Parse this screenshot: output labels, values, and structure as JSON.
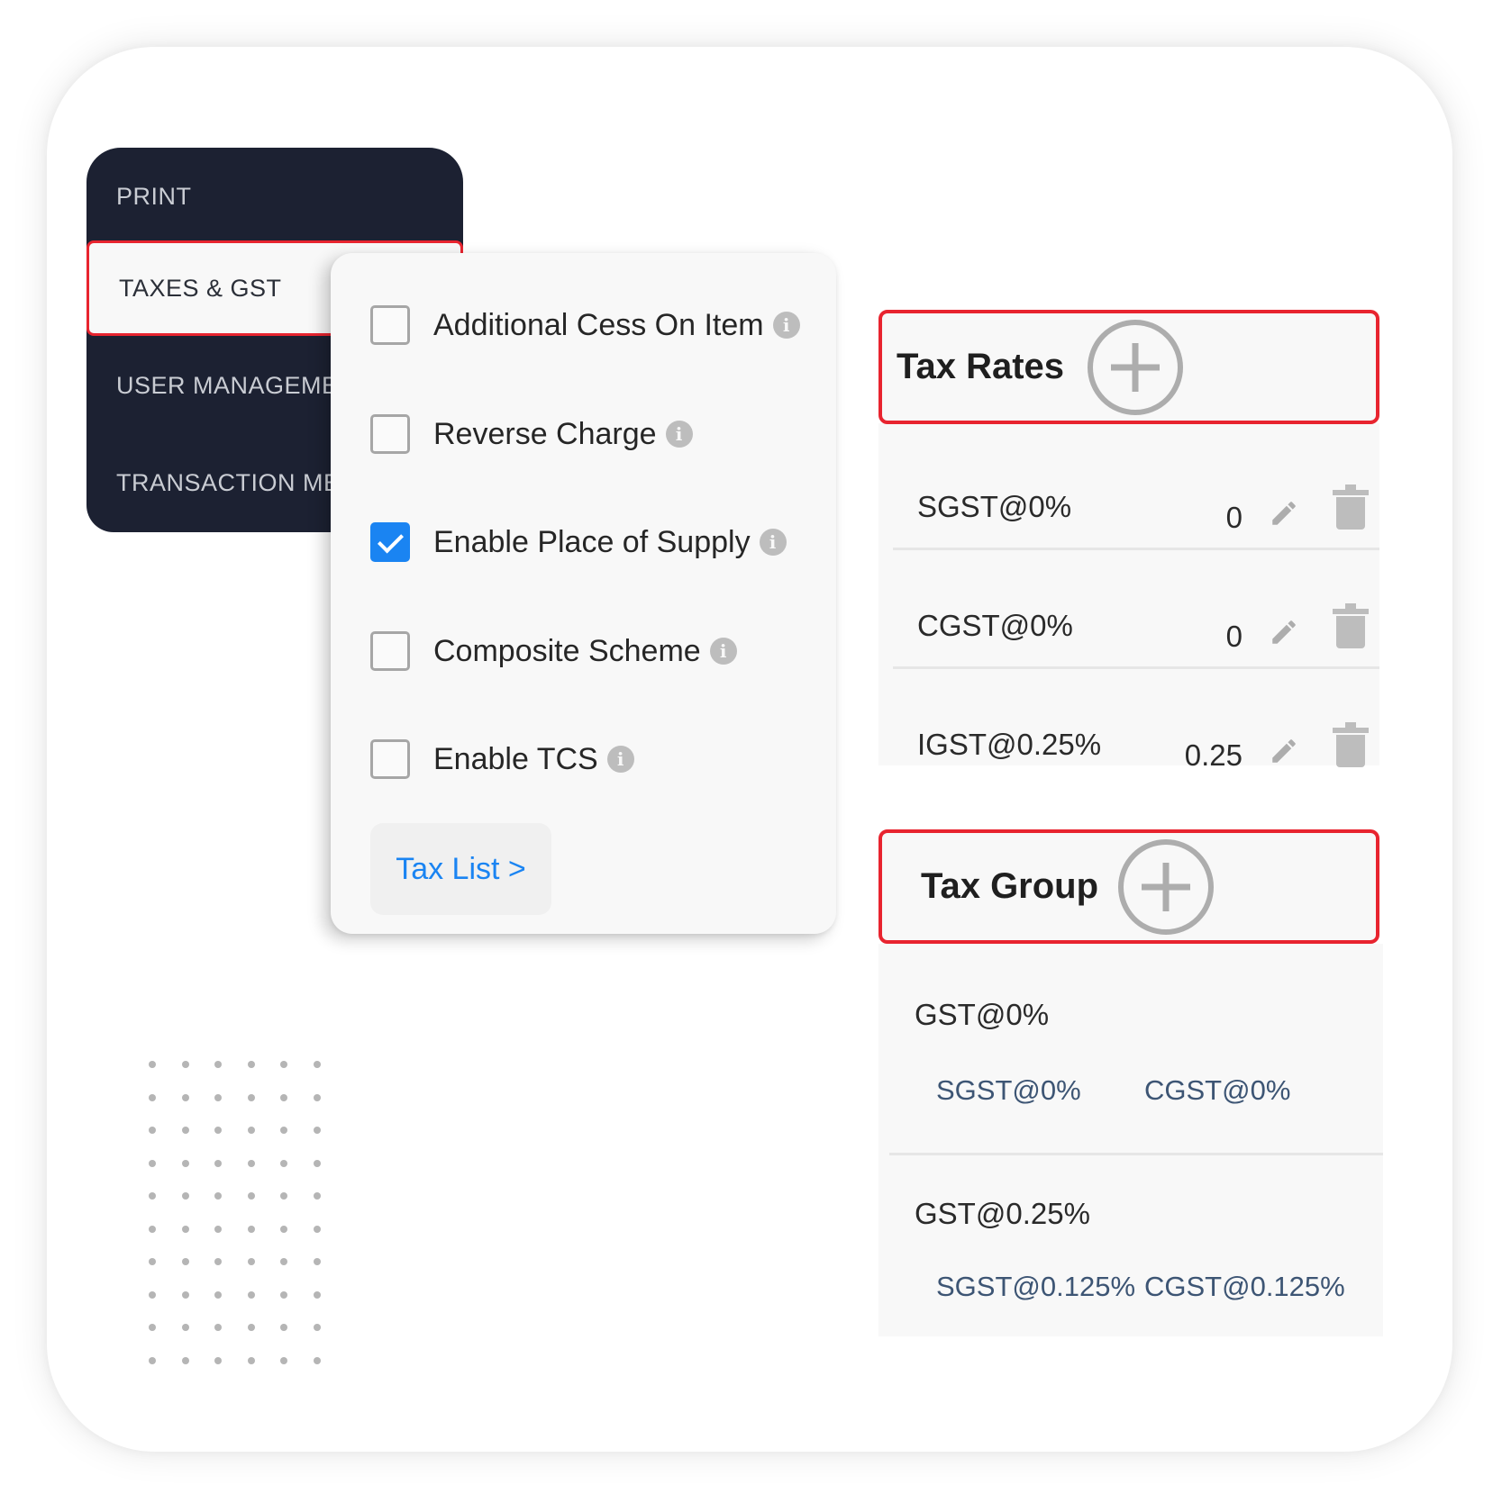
{
  "sidebar": {
    "items": [
      {
        "label": "PRINT",
        "active": false
      },
      {
        "label": "TAXES & GST",
        "active": true
      },
      {
        "label": "USER MANAGEMENT",
        "active": false
      },
      {
        "label": "TRANSACTION MESSAGE",
        "active": false
      }
    ]
  },
  "tax_settings": {
    "options": [
      {
        "label": "Additional Cess On Item",
        "checked": false,
        "info_icon": "info-icon"
      },
      {
        "label": "Reverse Charge",
        "checked": false,
        "info_icon": "info-icon"
      },
      {
        "label": "Enable Place of Supply",
        "checked": true,
        "info_icon": "info-icon"
      },
      {
        "label": "Composite Scheme",
        "checked": false,
        "info_icon": "info-icon"
      },
      {
        "label": "Enable TCS",
        "checked": false,
        "info_icon": "info-icon"
      }
    ],
    "tax_list_button": "Tax List >",
    "info_glyph": "i"
  },
  "tax_rates": {
    "title": "Tax Rates",
    "add_icon": "plus-circle-icon",
    "rows": [
      {
        "name": "SGST@0%",
        "value": "0"
      },
      {
        "name": "CGST@0%",
        "value": "0"
      },
      {
        "name": "IGST@0.25%",
        "value": "0.25"
      }
    ]
  },
  "tax_group": {
    "title": "Tax Group",
    "add_icon": "plus-circle-icon",
    "groups": [
      {
        "name": "GST@0%",
        "components": [
          "SGST@0%",
          "CGST@0%"
        ]
      },
      {
        "name": "GST@0.25%",
        "components": [
          "SGST@0.125%",
          "CGST@0.125%"
        ]
      }
    ]
  },
  "colors": {
    "highlight_border": "#e8242f",
    "sidebar_bg": "#1c2132",
    "accent_blue": "#1a84f2",
    "component_text": "#3d5574",
    "icon_gray": "#adadad"
  }
}
